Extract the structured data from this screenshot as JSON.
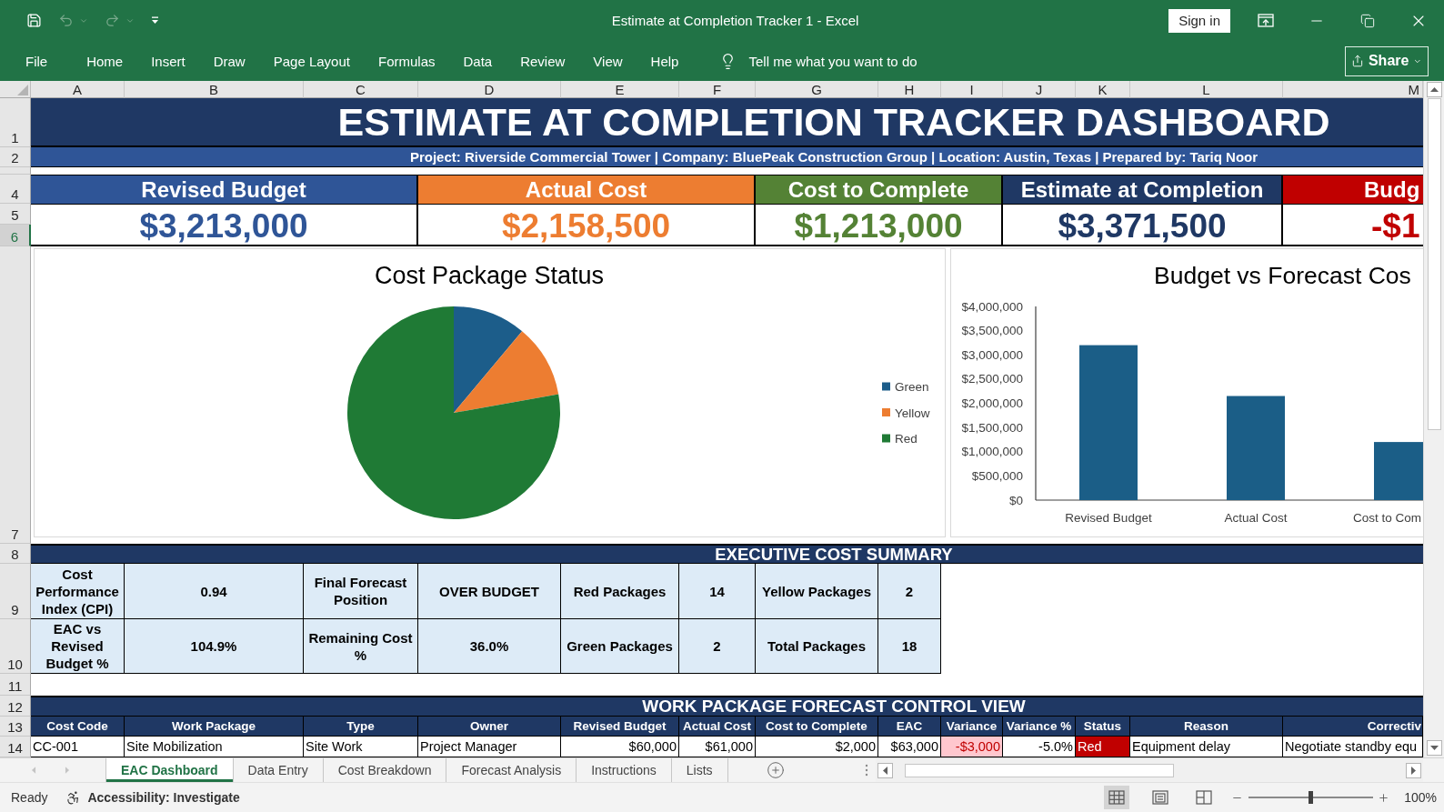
{
  "window": {
    "title": "Estimate at Completion Tracker 1 - Excel",
    "sign_in": "Sign in"
  },
  "quick_access": [
    {
      "kind": "save",
      "disabled": false
    },
    {
      "kind": "undo",
      "disabled": true
    },
    {
      "kind": "redo",
      "disabled": true
    },
    {
      "kind": "customize",
      "disabled": false
    }
  ],
  "ribbon": {
    "tabs": [
      "File",
      "Home",
      "Insert",
      "Draw",
      "Page Layout",
      "Formulas",
      "Data",
      "Review",
      "View",
      "Help"
    ],
    "tell_me": "Tell me what you want to do",
    "share": "Share"
  },
  "columns": [
    "A",
    "B",
    "C",
    "D",
    "E",
    "F",
    "G",
    "H",
    "I",
    "J",
    "K",
    "L",
    "M"
  ],
  "row_headers": [
    {
      "label": "1",
      "selected": false
    },
    {
      "label": "2",
      "selected": false
    },
    {
      "label": "4",
      "selected": false
    },
    {
      "label": "5",
      "selected": false
    },
    {
      "label": "6",
      "selected": true
    },
    {
      "label": "7",
      "selected": false
    },
    {
      "label": "8",
      "selected": false
    },
    {
      "label": "9",
      "selected": false
    },
    {
      "label": "10",
      "selected": false
    },
    {
      "label": "11",
      "selected": false
    },
    {
      "label": "12",
      "selected": false
    },
    {
      "label": "13",
      "selected": false
    },
    {
      "label": "14",
      "selected": false
    }
  ],
  "dashboard": {
    "title": "ESTIMATE AT COMPLETION TRACKER DASHBOARD",
    "subtitle": "Project: Riverside Commercial Tower | Company: BluePeak Construction Group | Location: Austin, Texas | Prepared by: Tariq Noor",
    "kpis": [
      {
        "label": "Revised Budget",
        "value": "$3,213,000",
        "color": "#2f5597"
      },
      {
        "label": "Actual Cost",
        "value": "$2,158,500",
        "color": "#ed7d31"
      },
      {
        "label": "Cost to Complete",
        "value": "$1,213,000",
        "color": "#548235"
      },
      {
        "label": "Estimate at Completion",
        "value": "$3,371,500",
        "color": "#1f3864"
      },
      {
        "label": "Budg",
        "value": "-$1",
        "color": "#c00000"
      }
    ]
  },
  "status_chart": {
    "chart_data": {
      "type": "pie",
      "title": "Cost Package Status",
      "categories": [
        "Green",
        "Yellow",
        "Red"
      ],
      "values": [
        11.1,
        11.1,
        77.8
      ],
      "colors": [
        "#1c5d8a",
        "#ed7d31",
        "#1f7a35"
      ],
      "legend": "right"
    }
  },
  "budget_chart": {
    "chart_data": {
      "type": "bar",
      "title": "Budget vs Forecast Cos",
      "categories": [
        "Revised Budget",
        "Actual Cost",
        "Cost to Com"
      ],
      "series": [
        {
          "color": "#1b5e87",
          "values": [
            3200000,
            2150000,
            1200000
          ]
        }
      ],
      "ylim": [
        0,
        4000000
      ],
      "yticks": [
        {
          "value": 0,
          "label": "$0"
        },
        {
          "value": 500000,
          "label": "$500,000"
        },
        {
          "value": 1000000,
          "label": "$1,000,000"
        },
        {
          "value": 1500000,
          "label": "$1,500,000"
        },
        {
          "value": 2000000,
          "label": "$2,000,000"
        },
        {
          "value": 2500000,
          "label": "$2,500,000"
        },
        {
          "value": 3000000,
          "label": "$3,000,000"
        },
        {
          "value": 3500000,
          "label": "$3,500,000"
        },
        {
          "value": 4000000,
          "label": "$4,000,000"
        }
      ]
    }
  },
  "summary": {
    "title": "EXECUTIVE COST SUMMARY",
    "rows": [
      [
        "Cost Performance Index (CPI)",
        "0.94",
        "Final Forecast Position",
        "OVER BUDGET",
        "Red Packages",
        "14",
        "Yellow Packages",
        "2"
      ],
      [
        "EAC vs Revised Budget %",
        "104.9%",
        "Remaining Cost %",
        "36.0%",
        "Green Packages",
        "2",
        "Total Packages",
        "18"
      ]
    ]
  },
  "forecast": {
    "title": "WORK PACKAGE FORECAST CONTROL VIEW",
    "columns": [
      "Cost Code",
      "Work Package",
      "Type",
      "Owner",
      "Revised Budget",
      "Actual Cost",
      "Cost to Complete",
      "EAC",
      "Variance",
      "Variance %",
      "Status",
      "Reason",
      "Correctiv"
    ],
    "rows": [
      {
        "cells": [
          {
            "text": "CC-001",
            "kind": "text"
          },
          {
            "text": "Site Mobilization",
            "kind": "text"
          },
          {
            "text": "Site Work",
            "kind": "text"
          },
          {
            "text": "Project Manager",
            "kind": "text"
          },
          {
            "text": "$60,000",
            "kind": "number"
          },
          {
            "text": "$61,000",
            "kind": "number"
          },
          {
            "text": "$2,000",
            "kind": "number"
          },
          {
            "text": "$63,000",
            "kind": "number"
          },
          {
            "text": "-$3,000",
            "kind": "alert"
          },
          {
            "text": "-5.0%",
            "kind": "number"
          },
          {
            "text": "Red",
            "kind": "status",
            "color": "#c00000"
          },
          {
            "text": "Equipment delay",
            "kind": "text"
          },
          {
            "text": "Negotiate standby equ",
            "kind": "text"
          }
        ]
      }
    ]
  },
  "sheet_tabs": [
    {
      "label": "EAC Dashboard",
      "selected": true
    },
    {
      "label": "Data Entry",
      "selected": false
    },
    {
      "label": "Cost Breakdown",
      "selected": false
    },
    {
      "label": "Forecast Analysis",
      "selected": false
    },
    {
      "label": "Instructions",
      "selected": false
    },
    {
      "label": "Lists",
      "selected": false
    }
  ],
  "status_bar": {
    "status": "Ready",
    "accessibility": "Accessibility: Investigate",
    "views": [
      {
        "kind": "normal",
        "selected": true
      },
      {
        "kind": "page_layout",
        "selected": false
      },
      {
        "kind": "page_break",
        "selected": false
      }
    ],
    "zoom": {
      "level": 0.5,
      "reading": "100%"
    }
  }
}
